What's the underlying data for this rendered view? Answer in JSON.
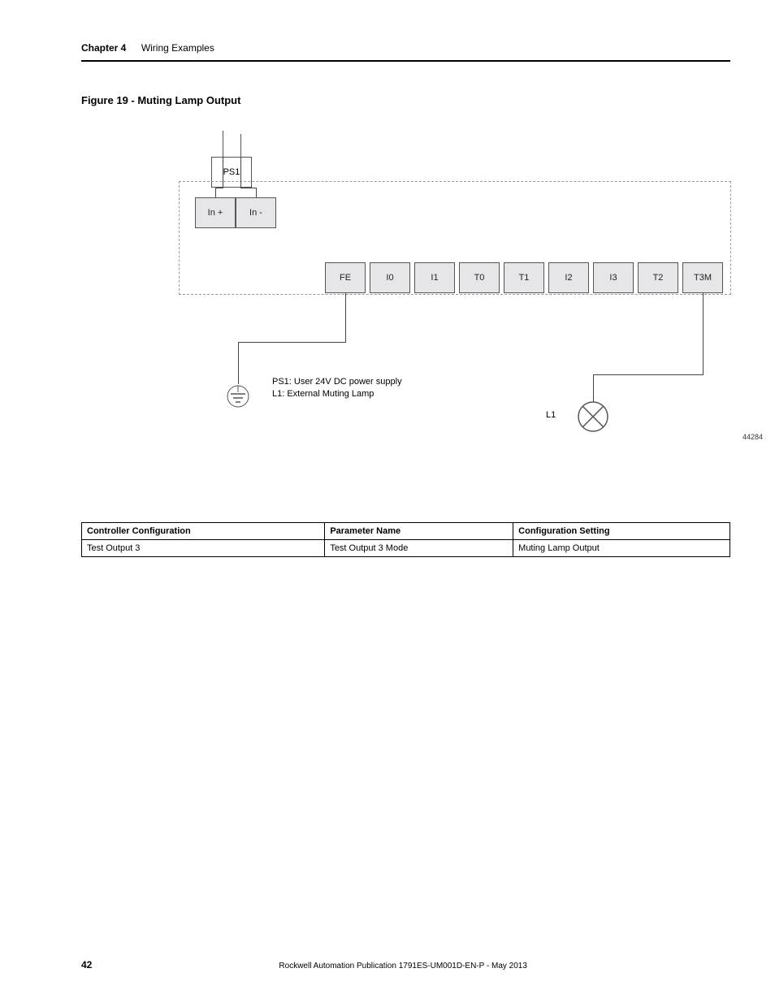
{
  "header": {
    "chapter_label": "Chapter 4",
    "chapter_title": "Wiring Examples"
  },
  "figure": {
    "title": "Figure 19 - Muting Lamp Output",
    "id_text": "44284",
    "ps1_label": "PS1",
    "terminals_top": {
      "in_plus": "In +",
      "in_minus": "In -"
    },
    "terminals_row": [
      "FE",
      "I0",
      "I1",
      "T0",
      "T1",
      "I2",
      "I3",
      "T2",
      "T3M"
    ],
    "lamp_label": "L1",
    "legend_line1": "PS1: User 24V DC power supply",
    "legend_line2": "L1: External Muting Lamp"
  },
  "table": {
    "headers": [
      "Controller Configuration",
      "Parameter Name",
      "Configuration Setting"
    ],
    "rows": [
      [
        "Test Output 3",
        "Test Output 3 Mode",
        "Muting Lamp Output"
      ]
    ]
  },
  "footer": {
    "page": "42",
    "publication": "Rockwell Automation Publication 1791ES-UM001D-EN-P - May 2013"
  }
}
